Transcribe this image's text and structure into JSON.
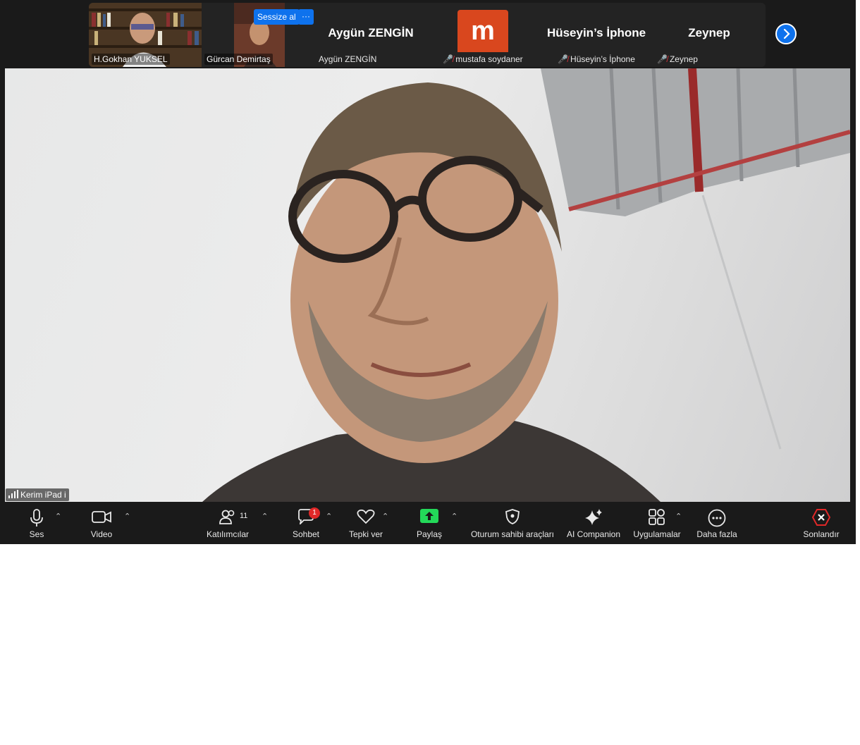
{
  "strip": {
    "tiles": [
      {
        "label": "H.Gokhan YUKSEL"
      },
      {
        "label": "Gürcan Demirtaş",
        "unmute_button": "Sessize al",
        "more_button": "···"
      },
      {
        "display_name": "Aygün ZENGİN",
        "label": "Aygün ZENGİN"
      },
      {
        "avatar_letter": "m",
        "label": "mustafa soydaner"
      },
      {
        "display_name": "Hüseyin’s İphone",
        "label": "Hüseyin’s İphone"
      },
      {
        "display_name": "Zeynep",
        "label": "Zeynep"
      }
    ],
    "avatar_color": "#d9471e"
  },
  "main": {
    "speaker_label": "Kerim iPad i"
  },
  "toolbar": {
    "audio": "Ses",
    "video": "Video",
    "participants": "Katılımcılar",
    "participants_count": "11",
    "chat": "Sohbet",
    "chat_badge": "1",
    "react": "Tepki ver",
    "share": "Paylaş",
    "host_tools": "Oturum sahibi araçları",
    "ai_companion": "AI Companion",
    "apps": "Uygulamalar",
    "more": "Daha fazla",
    "end": "Sonlandır"
  },
  "colors": {
    "accent": "#0e72ed",
    "share_green": "#23d959",
    "end_red": "#e02828",
    "background": "#1a1a1a"
  }
}
